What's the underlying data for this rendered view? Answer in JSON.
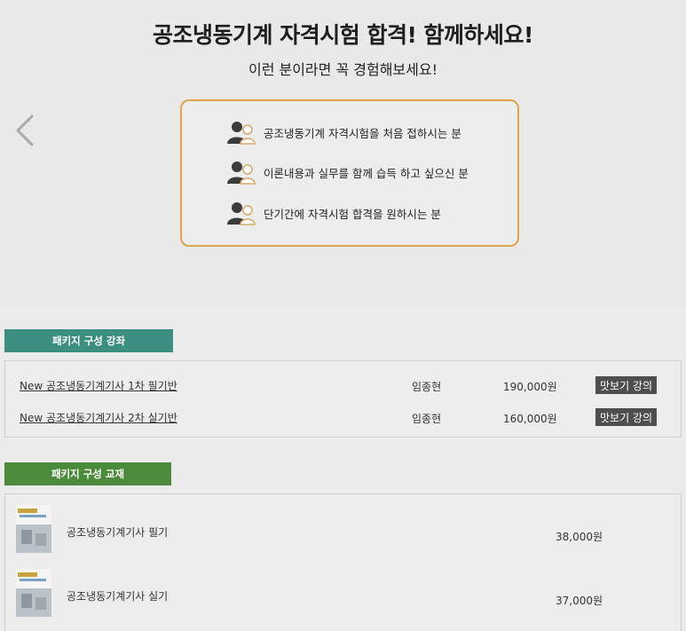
{
  "hero": {
    "title": "공조냉동기계 자격시험 합격! 함께하세요!",
    "subtitle": "이런 분이라면 꼭 경험해보세요!",
    "targets": [
      {
        "text": "공조냉동기계 자격시험을 처음 접하시는 분",
        "icon": "people-icon"
      },
      {
        "text": "이론내용과 실무를 함께 습득 하고 싶으신 분",
        "icon": "people-icon"
      },
      {
        "text": "단기간에 자격시험 합격을 원하시는 분",
        "icon": "people-icon"
      }
    ],
    "nav_icon": "chevron-left-icon",
    "accent_color": "#e0a44a"
  },
  "lecture_section": {
    "tab_label": "패키지 구성 강좌",
    "tab_color": "#3c8f80",
    "rows": [
      {
        "title": "New 공조냉동기계기사 1차 필기반",
        "teacher": "임종현",
        "price": "190,000원",
        "preview_label": "맛보기 강의"
      },
      {
        "title": "New 공조냉동기계기사 2차 실기반",
        "teacher": "임종현",
        "price": "160,000원",
        "preview_label": "맛보기 강의"
      }
    ]
  },
  "book_section": {
    "tab_label": "패키지 구성 교재",
    "tab_color": "#4c8a3c",
    "rows": [
      {
        "name": "공조냉동기계기사 필기",
        "price": "38,000원"
      },
      {
        "name": "공조냉동기계기사 실기",
        "price": "37,000원"
      }
    ]
  }
}
